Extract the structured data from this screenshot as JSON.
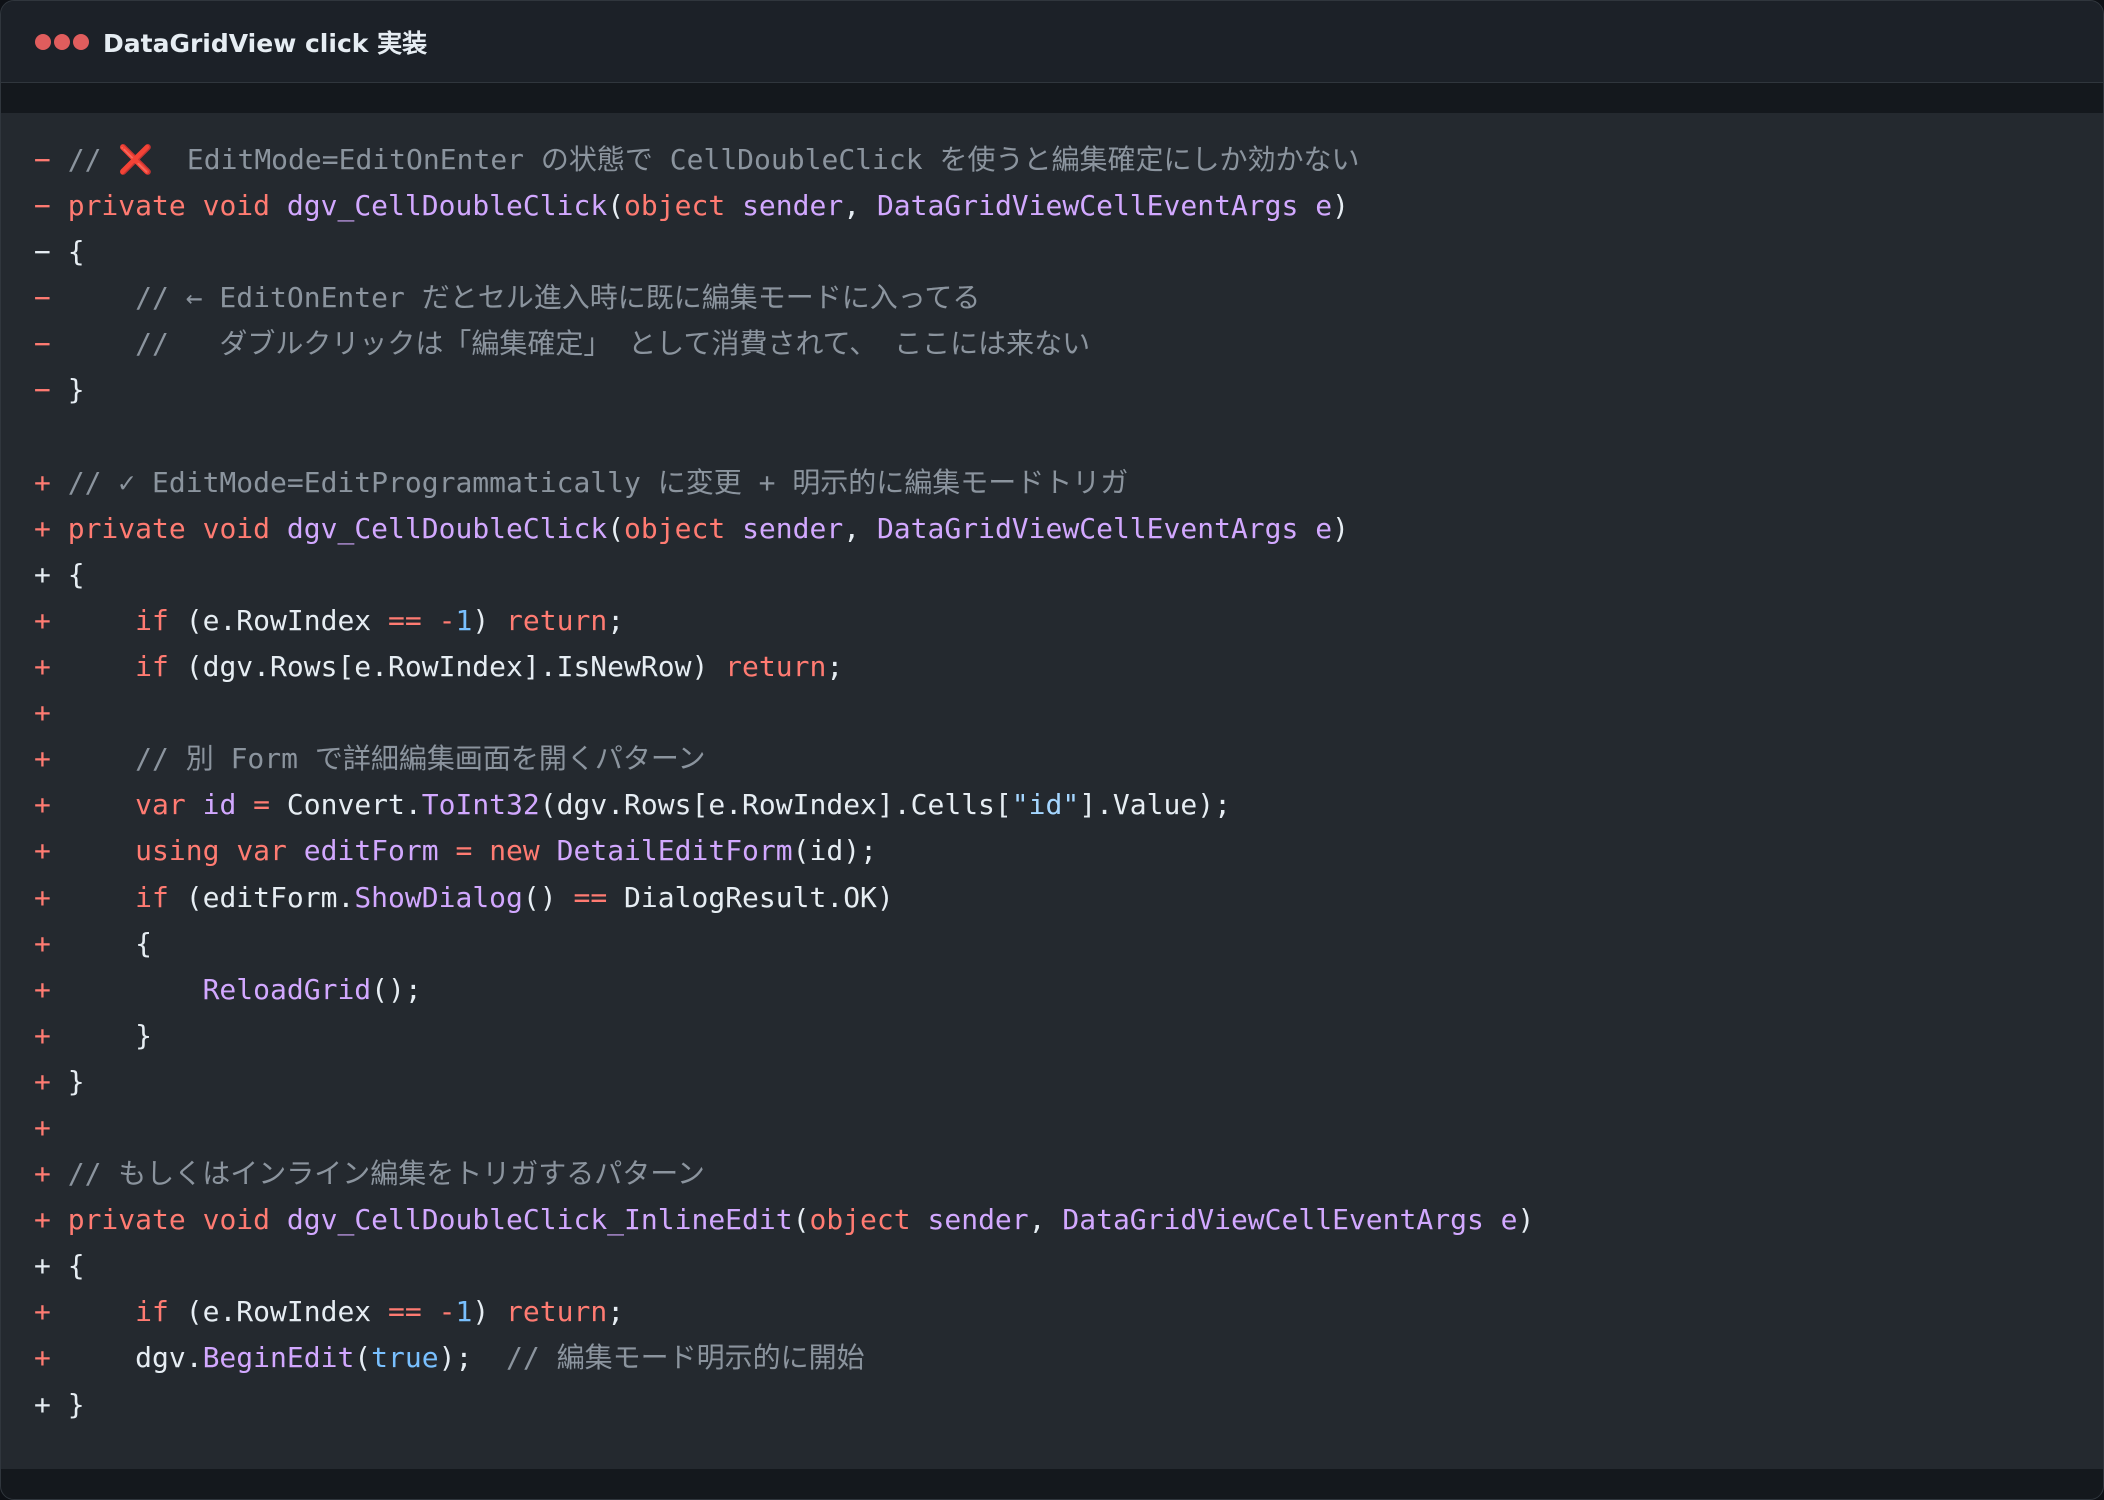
{
  "window": {
    "title": "DataGridView click 実装",
    "accent_dot_color": "#e05d5d"
  },
  "code": {
    "language": "csharp-diff",
    "lines": [
      {
        "marker": "−",
        "marker_type": "del",
        "tokens": [
          {
            "t": " // ",
            "c": "cm"
          },
          {
            "t": "❌",
            "c": "x"
          },
          {
            "t": "  EditMode=EditOnEnter の状態で CellDoubleClick を使うと編集確定にしか効かない",
            "c": "cm"
          }
        ]
      },
      {
        "marker": "−",
        "marker_type": "del",
        "tokens": [
          {
            "t": " ",
            "c": "pl"
          },
          {
            "t": "private",
            "c": "kw"
          },
          {
            "t": " ",
            "c": "pl"
          },
          {
            "t": "void",
            "c": "kw"
          },
          {
            "t": " ",
            "c": "pl"
          },
          {
            "t": "dgv_CellDoubleClick",
            "c": "fn"
          },
          {
            "t": "(",
            "c": "pl"
          },
          {
            "t": "object",
            "c": "kw"
          },
          {
            "t": " ",
            "c": "pl"
          },
          {
            "t": "sender",
            "c": "fn"
          },
          {
            "t": ", ",
            "c": "pl"
          },
          {
            "t": "DataGridViewCellEventArgs",
            "c": "fn"
          },
          {
            "t": " ",
            "c": "pl"
          },
          {
            "t": "e",
            "c": "fn"
          },
          {
            "t": ")",
            "c": "pl"
          }
        ]
      },
      {
        "marker": "−",
        "marker_type": "plain",
        "tokens": [
          {
            "t": " {",
            "c": "pl"
          }
        ]
      },
      {
        "marker": "−",
        "marker_type": "del",
        "tokens": [
          {
            "t": "     // ← EditOnEnter だとセル進入時に既に編集モードに入ってる",
            "c": "cm"
          }
        ]
      },
      {
        "marker": "−",
        "marker_type": "del",
        "tokens": [
          {
            "t": "     //   ダブルクリックは「編集確定」 として消費されて、 ここには来ない",
            "c": "cm"
          }
        ]
      },
      {
        "marker": "−",
        "marker_type": "del",
        "tokens": [
          {
            "t": " }",
            "c": "pl"
          }
        ]
      },
      {
        "marker": "",
        "marker_type": "plain",
        "tokens": []
      },
      {
        "marker": "+",
        "marker_type": "add",
        "tokens": [
          {
            "t": " // ✓ EditMode=EditProgrammatically に変更 + 明示的に編集モードトリガ",
            "c": "cm"
          }
        ]
      },
      {
        "marker": "+",
        "marker_type": "add",
        "tokens": [
          {
            "t": " ",
            "c": "pl"
          },
          {
            "t": "private",
            "c": "kw"
          },
          {
            "t": " ",
            "c": "pl"
          },
          {
            "t": "void",
            "c": "kw"
          },
          {
            "t": " ",
            "c": "pl"
          },
          {
            "t": "dgv_CellDoubleClick",
            "c": "fn"
          },
          {
            "t": "(",
            "c": "pl"
          },
          {
            "t": "object",
            "c": "kw"
          },
          {
            "t": " ",
            "c": "pl"
          },
          {
            "t": "sender",
            "c": "fn"
          },
          {
            "t": ", ",
            "c": "pl"
          },
          {
            "t": "DataGridViewCellEventArgs",
            "c": "fn"
          },
          {
            "t": " ",
            "c": "pl"
          },
          {
            "t": "e",
            "c": "fn"
          },
          {
            "t": ")",
            "c": "pl"
          }
        ]
      },
      {
        "marker": "+",
        "marker_type": "plain",
        "tokens": [
          {
            "t": " {",
            "c": "pl"
          }
        ]
      },
      {
        "marker": "+",
        "marker_type": "add",
        "tokens": [
          {
            "t": "     ",
            "c": "pl"
          },
          {
            "t": "if",
            "c": "kw"
          },
          {
            "t": " (e.RowIndex ",
            "c": "pl"
          },
          {
            "t": "==",
            "c": "kw"
          },
          {
            "t": " ",
            "c": "pl"
          },
          {
            "t": "-",
            "c": "kw"
          },
          {
            "t": "1",
            "c": "num"
          },
          {
            "t": ") ",
            "c": "pl"
          },
          {
            "t": "return",
            "c": "kw"
          },
          {
            "t": ";",
            "c": "pl"
          }
        ]
      },
      {
        "marker": "+",
        "marker_type": "add",
        "tokens": [
          {
            "t": "     ",
            "c": "pl"
          },
          {
            "t": "if",
            "c": "kw"
          },
          {
            "t": " (dgv.Rows[e.RowIndex].IsNewRow) ",
            "c": "pl"
          },
          {
            "t": "return",
            "c": "kw"
          },
          {
            "t": ";",
            "c": "pl"
          }
        ]
      },
      {
        "marker": "+",
        "marker_type": "add",
        "tokens": []
      },
      {
        "marker": "+",
        "marker_type": "add",
        "tokens": [
          {
            "t": "     // 別 Form で詳細編集画面を開くパターン",
            "c": "cm"
          }
        ]
      },
      {
        "marker": "+",
        "marker_type": "add",
        "tokens": [
          {
            "t": "     ",
            "c": "pl"
          },
          {
            "t": "var",
            "c": "kw"
          },
          {
            "t": " ",
            "c": "pl"
          },
          {
            "t": "id",
            "c": "fn"
          },
          {
            "t": " ",
            "c": "pl"
          },
          {
            "t": "=",
            "c": "kw"
          },
          {
            "t": " Convert.",
            "c": "pl"
          },
          {
            "t": "ToInt32",
            "c": "fn"
          },
          {
            "t": "(dgv.Rows[e.RowIndex].Cells[",
            "c": "pl"
          },
          {
            "t": "\"id\"",
            "c": "str"
          },
          {
            "t": "].Value);",
            "c": "pl"
          }
        ]
      },
      {
        "marker": "+",
        "marker_type": "add",
        "tokens": [
          {
            "t": "     ",
            "c": "pl"
          },
          {
            "t": "using",
            "c": "kw"
          },
          {
            "t": " ",
            "c": "pl"
          },
          {
            "t": "var",
            "c": "kw"
          },
          {
            "t": " ",
            "c": "pl"
          },
          {
            "t": "editForm",
            "c": "fn"
          },
          {
            "t": " ",
            "c": "pl"
          },
          {
            "t": "=",
            "c": "kw"
          },
          {
            "t": " ",
            "c": "pl"
          },
          {
            "t": "new",
            "c": "kw"
          },
          {
            "t": " ",
            "c": "pl"
          },
          {
            "t": "DetailEditForm",
            "c": "fn"
          },
          {
            "t": "(id);",
            "c": "pl"
          }
        ]
      },
      {
        "marker": "+",
        "marker_type": "add",
        "tokens": [
          {
            "t": "     ",
            "c": "pl"
          },
          {
            "t": "if",
            "c": "kw"
          },
          {
            "t": " (editForm.",
            "c": "pl"
          },
          {
            "t": "ShowDialog",
            "c": "fn"
          },
          {
            "t": "() ",
            "c": "pl"
          },
          {
            "t": "==",
            "c": "kw"
          },
          {
            "t": " DialogResult.OK)",
            "c": "pl"
          }
        ]
      },
      {
        "marker": "+",
        "marker_type": "add",
        "tokens": [
          {
            "t": "     {",
            "c": "pl"
          }
        ]
      },
      {
        "marker": "+",
        "marker_type": "add",
        "tokens": [
          {
            "t": "         ",
            "c": "pl"
          },
          {
            "t": "ReloadGrid",
            "c": "fn"
          },
          {
            "t": "();",
            "c": "pl"
          }
        ]
      },
      {
        "marker": "+",
        "marker_type": "add",
        "tokens": [
          {
            "t": "     }",
            "c": "pl"
          }
        ]
      },
      {
        "marker": "+",
        "marker_type": "add",
        "tokens": [
          {
            "t": " }",
            "c": "pl"
          }
        ]
      },
      {
        "marker": "+",
        "marker_type": "add",
        "tokens": []
      },
      {
        "marker": "+",
        "marker_type": "add",
        "tokens": [
          {
            "t": " // もしくはインライン編集をトリガするパターン",
            "c": "cm"
          }
        ]
      },
      {
        "marker": "+",
        "marker_type": "add",
        "tokens": [
          {
            "t": " ",
            "c": "pl"
          },
          {
            "t": "private",
            "c": "kw"
          },
          {
            "t": " ",
            "c": "pl"
          },
          {
            "t": "void",
            "c": "kw"
          },
          {
            "t": " ",
            "c": "pl"
          },
          {
            "t": "dgv_CellDoubleClick_InlineEdit",
            "c": "fn"
          },
          {
            "t": "(",
            "c": "pl"
          },
          {
            "t": "object",
            "c": "kw"
          },
          {
            "t": " ",
            "c": "pl"
          },
          {
            "t": "sender",
            "c": "fn"
          },
          {
            "t": ", ",
            "c": "pl"
          },
          {
            "t": "DataGridViewCellEventArgs",
            "c": "fn"
          },
          {
            "t": " ",
            "c": "pl"
          },
          {
            "t": "e",
            "c": "fn"
          },
          {
            "t": ")",
            "c": "pl"
          }
        ]
      },
      {
        "marker": "+",
        "marker_type": "plain",
        "tokens": [
          {
            "t": " {",
            "c": "pl"
          }
        ]
      },
      {
        "marker": "+",
        "marker_type": "add",
        "tokens": [
          {
            "t": "     ",
            "c": "pl"
          },
          {
            "t": "if",
            "c": "kw"
          },
          {
            "t": " (e.RowIndex ",
            "c": "pl"
          },
          {
            "t": "==",
            "c": "kw"
          },
          {
            "t": " ",
            "c": "pl"
          },
          {
            "t": "-",
            "c": "kw"
          },
          {
            "t": "1",
            "c": "num"
          },
          {
            "t": ") ",
            "c": "pl"
          },
          {
            "t": "return",
            "c": "kw"
          },
          {
            "t": ";",
            "c": "pl"
          }
        ]
      },
      {
        "marker": "+",
        "marker_type": "add",
        "tokens": [
          {
            "t": "     dgv.",
            "c": "pl"
          },
          {
            "t": "BeginEdit",
            "c": "fn"
          },
          {
            "t": "(",
            "c": "pl"
          },
          {
            "t": "true",
            "c": "num"
          },
          {
            "t": ");  ",
            "c": "pl"
          },
          {
            "t": "// 編集モード明示的に開始",
            "c": "cm"
          }
        ]
      },
      {
        "marker": "+",
        "marker_type": "plain",
        "tokens": [
          {
            "t": " }",
            "c": "pl"
          }
        ]
      }
    ]
  }
}
